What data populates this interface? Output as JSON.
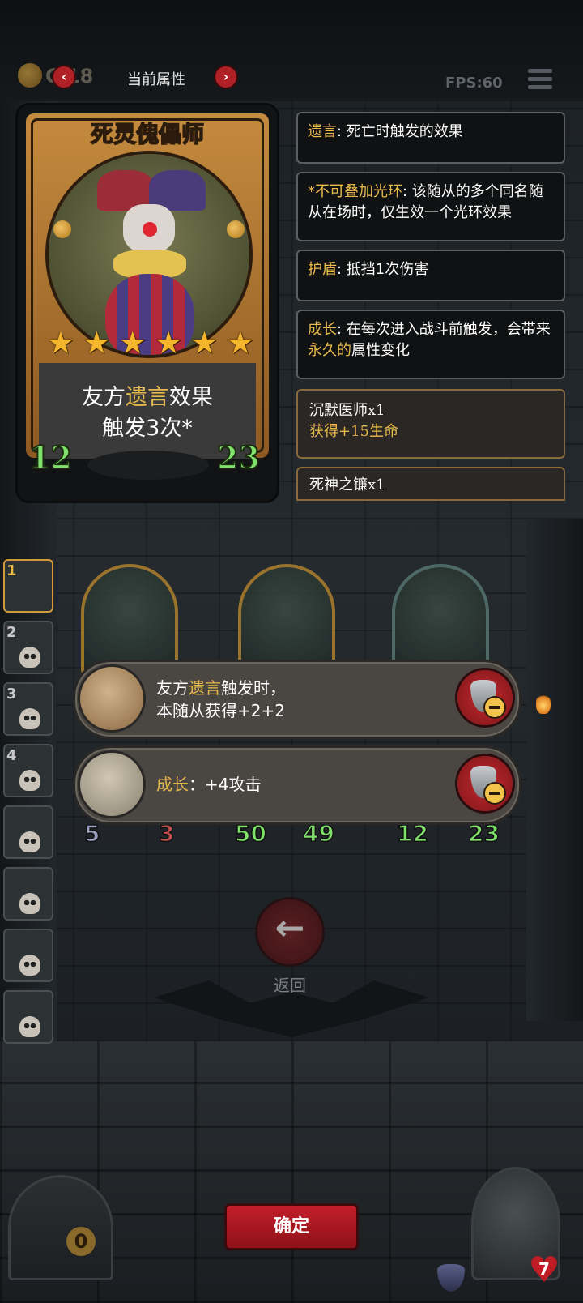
{
  "top_bar": {
    "coin_value": "C 18",
    "title": "当前属性",
    "prev_icon": "‹",
    "next_icon": "›",
    "fps": "FPS:60",
    "menu_icon": "menu-icon"
  },
  "card": {
    "name": "死灵傀儡师",
    "stars": 6,
    "desc_line1_a": "友方",
    "desc_line1_b": "遗言",
    "desc_line1_c": "效果",
    "desc_line2": "触发3次*",
    "attack": "12",
    "health": "23"
  },
  "keywords": [
    {
      "key": "遗言",
      "text": ": 死亡时触发的效果"
    },
    {
      "key": "*不可叠加光环",
      "text": ": 该随从的多个同名随从在场时，仅生效一个光环效果"
    },
    {
      "key": "护盾",
      "text": ": 抵挡1次伤害"
    },
    {
      "key": "成长",
      "text_a": ": 在每次进入战斗前触发，会带来",
      "highlight": "永久的",
      "text_b": "属性变化"
    }
  ],
  "equipment": [
    {
      "name": "沉默医师x1",
      "bonus": "获得+15生命"
    },
    {
      "name": "死神之镰x1",
      "bonus": ""
    }
  ],
  "roster": [
    "1",
    "2",
    "3",
    "4",
    "",
    "",
    "",
    ""
  ],
  "board_stats": [
    "5",
    "3",
    "50",
    "49",
    "12",
    "23"
  ],
  "popups": [
    {
      "line1_a": "友方",
      "line1_b": "遗言",
      "line1_c": "触发时，",
      "line2": "本随从获得+2+2",
      "icon": "shield-wheel-icon"
    },
    {
      "label": "成长",
      "text": "：+4攻击",
      "icon": "scythe-icon"
    }
  ],
  "back_label": "返回",
  "confirm_label": "确定",
  "gate_count": "0",
  "hero_health": "7",
  "colors": {
    "accent_gold": "#e8b94c",
    "button_red": "#c21f2a",
    "stat_green": "#7fe06a"
  }
}
